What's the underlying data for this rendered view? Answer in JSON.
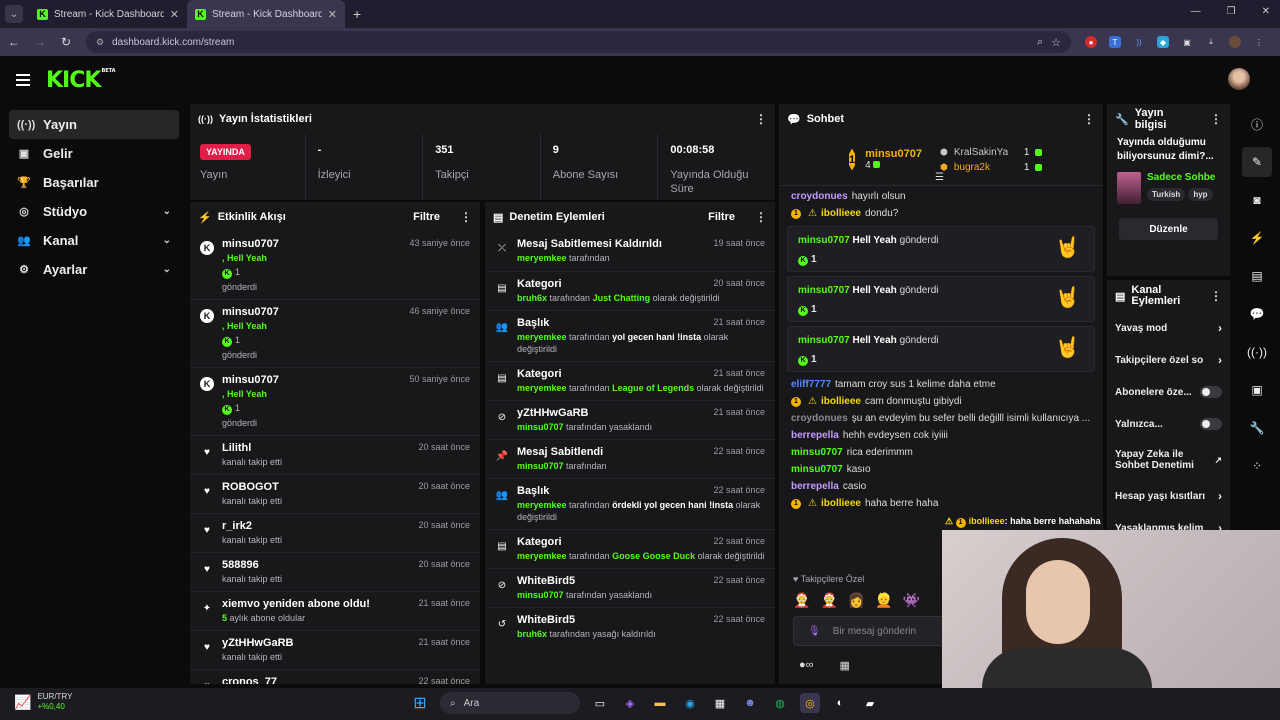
{
  "browser": {
    "tabs": [
      {
        "title": "Stream - Kick Dashboard",
        "active": false
      },
      {
        "title": "Stream - Kick Dashboard",
        "active": true
      }
    ],
    "url": "dashboard.kick.com/stream"
  },
  "header": {
    "logo": "KICK",
    "logo_badge": "BETA"
  },
  "sidebar": {
    "items": [
      {
        "label": "Yayın",
        "icon": "broadcast-icon",
        "glyph": "((·))",
        "active": true,
        "expandable": false
      },
      {
        "label": "Gelir",
        "icon": "revenue-icon",
        "glyph": "▣",
        "active": false,
        "expandable": false
      },
      {
        "label": "Başarılar",
        "icon": "trophy-icon",
        "glyph": "🏆",
        "active": false,
        "expandable": false
      },
      {
        "label": "Stüdyo",
        "icon": "studio-icon",
        "glyph": "◎",
        "active": false,
        "expandable": true
      },
      {
        "label": "Kanal",
        "icon": "channel-icon",
        "glyph": "👥",
        "active": false,
        "expandable": true
      },
      {
        "label": "Ayarlar",
        "icon": "settings-icon",
        "glyph": "⚙",
        "active": false,
        "expandable": true
      }
    ]
  },
  "stats": {
    "title": "Yayın İstatistikleri",
    "live_badge": "YAYINDA",
    "items": [
      {
        "value": "",
        "label": "Yayın"
      },
      {
        "value": "-",
        "label": "İzleyici"
      },
      {
        "value": "351",
        "label": "Takipçi"
      },
      {
        "value": "9",
        "label": "Abone Sayısı"
      },
      {
        "value": "00:08:58",
        "label": "Yayında Olduğu Süre"
      }
    ]
  },
  "activity": {
    "title": "Etkinlik Akışı",
    "filter": "Filtre",
    "items": [
      {
        "icon": "kick-icon",
        "glyph": "K",
        "circle": true,
        "user": "minsu0707",
        "time": "43 saniye önce",
        "line1": ", Hell Yeah",
        "count": "1",
        "line3": "gönderdi"
      },
      {
        "icon": "kick-icon",
        "glyph": "K",
        "circle": true,
        "user": "minsu0707",
        "time": "46 saniye önce",
        "line1": ", Hell Yeah",
        "count": "1",
        "line3": "gönderdi"
      },
      {
        "icon": "kick-icon",
        "glyph": "K",
        "circle": true,
        "user": "minsu0707",
        "time": "50 saniye önce",
        "line1": ", Hell Yeah",
        "count": "1",
        "line3": "gönderdi"
      },
      {
        "icon": "heart-icon",
        "glyph": "♥",
        "circle": false,
        "user": "Lilithl",
        "time": "20 saat önce",
        "sub": "kanalı takip etti"
      },
      {
        "icon": "heart-icon",
        "glyph": "♥",
        "circle": false,
        "user": "ROBOGOT",
        "time": "20 saat önce",
        "sub": "kanalı takip etti"
      },
      {
        "icon": "heart-icon",
        "glyph": "♥",
        "circle": false,
        "user": "r_irk2",
        "time": "20 saat önce",
        "sub": "kanalı takip etti"
      },
      {
        "icon": "heart-icon",
        "glyph": "♥",
        "circle": false,
        "user": "588896",
        "time": "20 saat önce",
        "sub": "kanalı takip etti"
      },
      {
        "icon": "sparkle-icon",
        "glyph": "✦",
        "circle": false,
        "user": "xiemvo yeniden abone oldu!",
        "time": "21 saat önce",
        "sub_green": "5",
        "sub": " aylık abone oldular"
      },
      {
        "icon": "heart-icon",
        "glyph": "♥",
        "circle": false,
        "user": "yZtHHwGaRB",
        "time": "21 saat önce",
        "sub": "kanalı takip etti"
      },
      {
        "icon": "heart-icon",
        "glyph": "♥",
        "circle": false,
        "user": "cronos_77",
        "time": "22 saat önce",
        "sub": ""
      }
    ]
  },
  "moderation": {
    "title": "Denetim Eylemleri",
    "filter": "Filtre",
    "items": [
      {
        "icon": "unpin-icon",
        "glyph": "⤫",
        "title": "Mesaj Sabitlemesi Kaldırıldı",
        "time": "19 saat önce",
        "parts": [
          [
            "g",
            "meryemkee"
          ],
          [
            "t",
            " tarafından"
          ]
        ]
      },
      {
        "icon": "category-icon",
        "glyph": "▤",
        "title": "Kategori",
        "time": "20 saat önce",
        "parts": [
          [
            "g",
            "bruh6x"
          ],
          [
            "t",
            " tarafından "
          ],
          [
            "g",
            "Just Chatting"
          ],
          [
            "t",
            " olarak değiştirildi"
          ]
        ]
      },
      {
        "icon": "title-icon",
        "glyph": "👥",
        "title": "Başlık",
        "time": "21 saat önce",
        "parts": [
          [
            "g",
            "meryemkee"
          ],
          [
            "t",
            " tarafından "
          ],
          [
            "w",
            "yol gecen hani !insta"
          ],
          [
            "t",
            " olarak değiştirildi"
          ]
        ]
      },
      {
        "icon": "category-icon",
        "glyph": "▤",
        "title": "Kategori",
        "time": "21 saat önce",
        "parts": [
          [
            "g",
            "meryemkee"
          ],
          [
            "t",
            " tarafından "
          ],
          [
            "g",
            "League of Legends"
          ],
          [
            "t",
            " olarak değiştirildi"
          ]
        ]
      },
      {
        "icon": "ban-icon",
        "glyph": "⊘",
        "title": "yZtHHwGaRB",
        "time": "21 saat önce",
        "parts": [
          [
            "g",
            "minsu0707"
          ],
          [
            "t",
            " tarafından yasaklandı"
          ]
        ]
      },
      {
        "icon": "pin-icon",
        "glyph": "📌",
        "title": "Mesaj Sabitlendi",
        "time": "22 saat önce",
        "parts": [
          [
            "g",
            "minsu0707"
          ],
          [
            "t",
            " tarafından"
          ]
        ]
      },
      {
        "icon": "title-icon",
        "glyph": "👥",
        "title": "Başlık",
        "time": "22 saat önce",
        "parts": [
          [
            "g",
            "meryemkee"
          ],
          [
            "t",
            " tarafından "
          ],
          [
            "w",
            "ördekli yol gecen hani !insta"
          ],
          [
            "t",
            " olarak değiştirildi"
          ]
        ]
      },
      {
        "icon": "category-icon",
        "glyph": "▤",
        "title": "Kategori",
        "time": "22 saat önce",
        "parts": [
          [
            "g",
            "meryemkee"
          ],
          [
            "t",
            " tarafından "
          ],
          [
            "g",
            "Goose Goose Duck"
          ],
          [
            "t",
            " olarak değiştirildi"
          ]
        ]
      },
      {
        "icon": "ban-icon",
        "glyph": "⊘",
        "title": "WhiteBird5",
        "time": "22 saat önce",
        "parts": [
          [
            "g",
            "minsu0707"
          ],
          [
            "t",
            " tarafından yasaklandı"
          ]
        ]
      },
      {
        "icon": "unban-icon",
        "glyph": "↺",
        "title": "WhiteBird5",
        "time": "22 saat önce",
        "parts": [
          [
            "g",
            "bruh6x"
          ],
          [
            "t",
            " tarafından yasağı kaldırıldı"
          ]
        ]
      }
    ]
  },
  "chat": {
    "title": "Sohbet",
    "leaderboard": {
      "rank": "1",
      "top_user": "minsu0707",
      "top_count": "4",
      "others": [
        {
          "user": "KralSakinYa",
          "count": "1",
          "color": "#c8c8c8"
        },
        {
          "user": "bugra2k",
          "count": "1",
          "color": "#f5a623"
        }
      ]
    },
    "lines_top": [
      {
        "user": "croydonues",
        "color": "#c59bff",
        "text": "hayırlı olsun",
        "badge": ""
      },
      {
        "user": "ibollieee",
        "color": "#f5d90a",
        "text": "dondu?",
        "badge": "1"
      }
    ],
    "gifts": [
      {
        "user": "minsu0707",
        "text": "Hell Yeah",
        "suffix": "gönderdi",
        "count": "1",
        "emoji": "🤘"
      },
      {
        "user": "minsu0707",
        "text": "Hell Yeah",
        "suffix": "gönderdi",
        "count": "1",
        "emoji": "🤘"
      },
      {
        "user": "minsu0707",
        "text": "Hell Yeah",
        "suffix": "gönderdi",
        "count": "1",
        "emoji": "🤘"
      }
    ],
    "lines_bottom": [
      {
        "user": "eliff7777",
        "color": "#4f8cff",
        "text": "tamam croy sus 1 kelime daha etme"
      },
      {
        "user": "ibollieee",
        "color": "#f5d90a",
        "text": "cam donmuştu gibiydi"
      },
      {
        "user": "croydonues",
        "color": "#8a8a90",
        "text": "şu an evdeyim bu sefer belli değilll isimli kullanıcıya ..."
      },
      {
        "user": "berrepella",
        "color": "#c59bff",
        "text": "hehh evdeysen cok iyiiii"
      },
      {
        "user": "minsu0707",
        "color": "#53fc18",
        "text": "rica ederimmm"
      },
      {
        "user": "minsu0707",
        "color": "#53fc18",
        "text": "kasıo"
      },
      {
        "user": "berrepella",
        "color": "#c59bff",
        "text": "casio"
      },
      {
        "user": "ibollieee",
        "color": "#f5d90a",
        "text": "haha berre haha"
      }
    ],
    "overlay_line": {
      "user": "ibollieee",
      "text": "haha berre hahahaha"
    },
    "follower_label": "Takipçilere Özel",
    "placeholder": "Bir mesaj gönderin"
  },
  "stream_info": {
    "title": "Yayın bilgisi",
    "did_you_know": "Yayında olduğumu biliyorsunuz dimi?...",
    "category": "Sadece Sohbe",
    "tags": [
      "Turkish",
      "hyp"
    ],
    "edit_button": "Düzenle"
  },
  "channel_actions": {
    "title": "Kanal Eylemleri",
    "items": [
      {
        "label": "Yavaş mod",
        "type": "chevron"
      },
      {
        "label": "Takipçilere özel so",
        "type": "chevron"
      },
      {
        "label": "Abonelere öze...",
        "type": "toggle"
      },
      {
        "label": "Yalnızca...",
        "type": "toggle"
      },
      {
        "label": "Yapay Zeka ile Sohbet Denetimi",
        "type": "external"
      },
      {
        "label": "Hesap yaşı kısıtları",
        "type": "chevron"
      },
      {
        "label": "Yasaklanmış kelim",
        "type": "chevron"
      }
    ]
  },
  "taskbar": {
    "ticker_pair": "EUR/TRY",
    "ticker_change": "+%0,40",
    "search": "Ara"
  },
  "colors": {
    "brand": "#53fc18",
    "live": "#e11d48"
  }
}
